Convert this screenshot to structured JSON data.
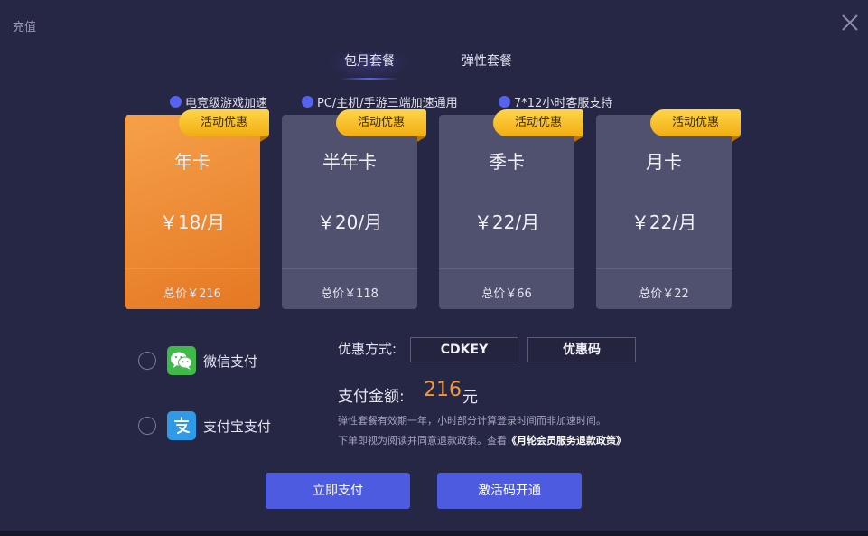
{
  "title": "充值",
  "tabs": [
    {
      "label": "包月套餐"
    },
    {
      "label": "弹性套餐"
    }
  ],
  "features": [
    "电竞级游戏加速",
    "PC/主机/手游三端加速通用",
    "7*12小时客服支持"
  ],
  "plans": [
    {
      "badge": "活动优惠",
      "name": "年卡",
      "price": "￥18/月",
      "total": "总价￥216"
    },
    {
      "badge": "活动优惠",
      "name": "半年卡",
      "price": "￥20/月",
      "total": "总价￥118"
    },
    {
      "badge": "活动优惠",
      "name": "季卡",
      "price": "￥22/月",
      "total": "总价￥66"
    },
    {
      "badge": "活动优惠",
      "name": "月卡",
      "price": "￥22/月",
      "total": "总价￥22"
    }
  ],
  "payment_methods": [
    {
      "label": "微信支付"
    },
    {
      "label": "支付宝支付"
    }
  ],
  "discount": {
    "label": "优惠方式:",
    "options": [
      "CDKEY",
      "优惠码"
    ]
  },
  "amount": {
    "label": "支付金额:",
    "value": "216",
    "unit": "元"
  },
  "notes": {
    "line1": "弹性套餐有效期一年，小时部分计算登录时间而非加速时间。",
    "line2": "下单即视为阅读并同意退款政策。查看",
    "policy_link": "《月轮会员服务退款政策》"
  },
  "buttons": {
    "pay_now": "立即支付",
    "activate_code": "激活码开通"
  },
  "colors": {
    "accent": "#4c5be0",
    "selected_card": "#f08a36",
    "badge": "#f5b820",
    "amount": "#f29a3a"
  }
}
